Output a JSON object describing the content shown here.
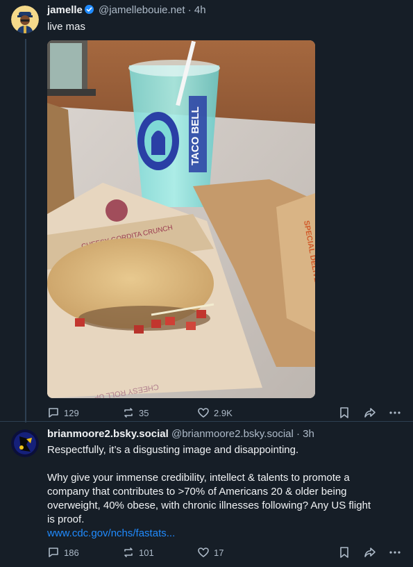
{
  "post1": {
    "display_name": "jamelle",
    "handle": "@jamellebouie.net",
    "separator": "·",
    "time": "4h",
    "text": "live mas",
    "image": {
      "cup_brand": "TACO BELL",
      "wrapper_text": "CHEESY GORDITA CRUNCH",
      "bottom_wrapper_text": "CHEESY ROLL UP",
      "bag_text": "SPECIAL DELIVERY"
    },
    "actions": {
      "replies": "129",
      "reposts": "35",
      "likes": "2.9K"
    }
  },
  "post2": {
    "display_name": "brianmoore2.bsky.social",
    "handle": "@brianmoore2.bsky.social",
    "separator": "·",
    "time": "3h",
    "line1": "Respectfully, it’s a disgusting image and disappointing.",
    "line2": "Why give your immense credibility, intellect & talents to promote a",
    "line3": "company that contributes to >70% of Americans 20 & older being",
    "line4": "overweight, 40% obese, with chronic illnesses following? Any US flight",
    "line5": "is proof.",
    "link": "www.cdc.gov/nchs/fastats...",
    "actions": {
      "replies": "186",
      "reposts": "101",
      "likes": "17"
    }
  },
  "colors": {
    "background": "#161e27",
    "accent": "#208bfe",
    "muted": "#aebbc9",
    "text": "#f1f3f5",
    "border": "#2e4052"
  }
}
